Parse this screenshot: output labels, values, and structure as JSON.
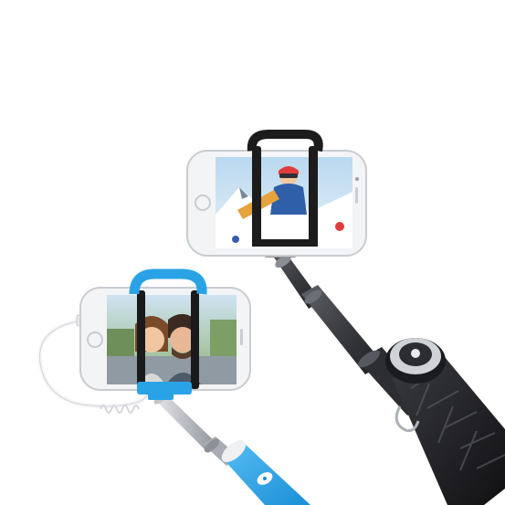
{
  "image": {
    "background": "#ffffff",
    "colors": {
      "blue_accent": "#2aa3e6",
      "black_mount": "#1c1c1c",
      "pole_silver": "#c8cbd0",
      "pole_dark": "#2b2d31",
      "phone_white": "#f3f4f6"
    },
    "objects": [
      "selfie-stick-black",
      "selfie-stick-blue",
      "smartphone-left",
      "smartphone-right",
      "selfie-cable"
    ]
  }
}
